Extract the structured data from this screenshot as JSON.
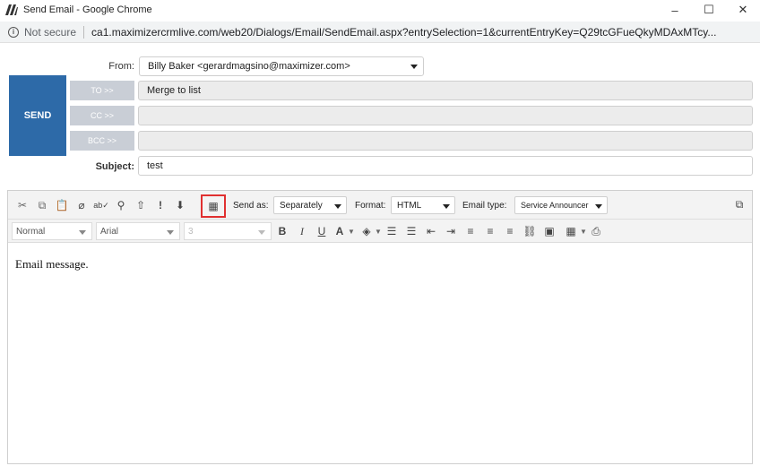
{
  "window": {
    "title": "Send Email - Google Chrome",
    "controls": {
      "minimize": "–",
      "maximize": "☐",
      "close": "✕"
    }
  },
  "address": {
    "security": "Not secure",
    "url": "ca1.maximizercrmlive.com/web20/Dialogs/Email/SendEmail.aspx?entrySelection=1&currentEntryKey=Q29tcGFueQkyMDAxMTcy..."
  },
  "form": {
    "from_label": "From:",
    "from_value": "Billy Baker <gerardmagsino@maximizer.com>",
    "send_label": "SEND",
    "to_label": "TO >>",
    "to_value": "Merge to list",
    "cc_label": "CC >>",
    "cc_value": "",
    "bcc_label": "BCC >>",
    "bcc_value": "",
    "subject_label": "Subject:",
    "subject_value": "test"
  },
  "toolbar": {
    "send_as_label": "Send as:",
    "send_as_value": "Separately",
    "format_label": "Format:",
    "format_value": "HTML",
    "email_type_label": "Email type:",
    "email_type_value": "Service Announcer"
  },
  "toolbar2": {
    "style_value": "Normal",
    "font_value": "Arial",
    "size_value": "3"
  },
  "editor": {
    "body": "Email message."
  },
  "colors": {
    "send_button": "#2d6aa8",
    "recipient_button": "#c9ced6",
    "highlight": "#e03030"
  }
}
